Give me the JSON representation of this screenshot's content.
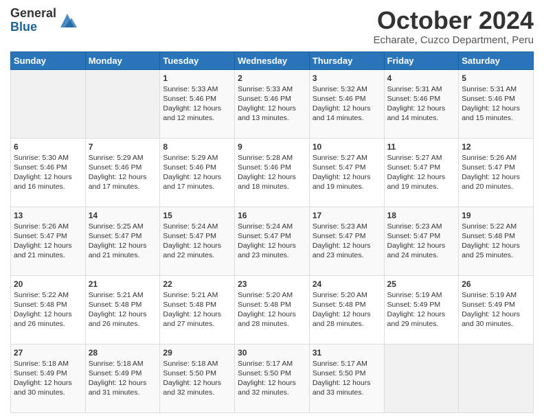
{
  "logo": {
    "general": "General",
    "blue": "Blue"
  },
  "header": {
    "title": "October 2024",
    "subtitle": "Echarate, Cuzco Department, Peru"
  },
  "weekdays": [
    "Sunday",
    "Monday",
    "Tuesday",
    "Wednesday",
    "Thursday",
    "Friday",
    "Saturday"
  ],
  "weeks": [
    [
      {
        "day": null,
        "sunrise": null,
        "sunset": null,
        "daylight": null
      },
      {
        "day": null,
        "sunrise": null,
        "sunset": null,
        "daylight": null
      },
      {
        "day": "1",
        "sunrise": "Sunrise: 5:33 AM",
        "sunset": "Sunset: 5:46 PM",
        "daylight": "Daylight: 12 hours and 12 minutes."
      },
      {
        "day": "2",
        "sunrise": "Sunrise: 5:33 AM",
        "sunset": "Sunset: 5:46 PM",
        "daylight": "Daylight: 12 hours and 13 minutes."
      },
      {
        "day": "3",
        "sunrise": "Sunrise: 5:32 AM",
        "sunset": "Sunset: 5:46 PM",
        "daylight": "Daylight: 12 hours and 14 minutes."
      },
      {
        "day": "4",
        "sunrise": "Sunrise: 5:31 AM",
        "sunset": "Sunset: 5:46 PM",
        "daylight": "Daylight: 12 hours and 14 minutes."
      },
      {
        "day": "5",
        "sunrise": "Sunrise: 5:31 AM",
        "sunset": "Sunset: 5:46 PM",
        "daylight": "Daylight: 12 hours and 15 minutes."
      }
    ],
    [
      {
        "day": "6",
        "sunrise": "Sunrise: 5:30 AM",
        "sunset": "Sunset: 5:46 PM",
        "daylight": "Daylight: 12 hours and 16 minutes."
      },
      {
        "day": "7",
        "sunrise": "Sunrise: 5:29 AM",
        "sunset": "Sunset: 5:46 PM",
        "daylight": "Daylight: 12 hours and 17 minutes."
      },
      {
        "day": "8",
        "sunrise": "Sunrise: 5:29 AM",
        "sunset": "Sunset: 5:46 PM",
        "daylight": "Daylight: 12 hours and 17 minutes."
      },
      {
        "day": "9",
        "sunrise": "Sunrise: 5:28 AM",
        "sunset": "Sunset: 5:46 PM",
        "daylight": "Daylight: 12 hours and 18 minutes."
      },
      {
        "day": "10",
        "sunrise": "Sunrise: 5:27 AM",
        "sunset": "Sunset: 5:47 PM",
        "daylight": "Daylight: 12 hours and 19 minutes."
      },
      {
        "day": "11",
        "sunrise": "Sunrise: 5:27 AM",
        "sunset": "Sunset: 5:47 PM",
        "daylight": "Daylight: 12 hours and 19 minutes."
      },
      {
        "day": "12",
        "sunrise": "Sunrise: 5:26 AM",
        "sunset": "Sunset: 5:47 PM",
        "daylight": "Daylight: 12 hours and 20 minutes."
      }
    ],
    [
      {
        "day": "13",
        "sunrise": "Sunrise: 5:26 AM",
        "sunset": "Sunset: 5:47 PM",
        "daylight": "Daylight: 12 hours and 21 minutes."
      },
      {
        "day": "14",
        "sunrise": "Sunrise: 5:25 AM",
        "sunset": "Sunset: 5:47 PM",
        "daylight": "Daylight: 12 hours and 21 minutes."
      },
      {
        "day": "15",
        "sunrise": "Sunrise: 5:24 AM",
        "sunset": "Sunset: 5:47 PM",
        "daylight": "Daylight: 12 hours and 22 minutes."
      },
      {
        "day": "16",
        "sunrise": "Sunrise: 5:24 AM",
        "sunset": "Sunset: 5:47 PM",
        "daylight": "Daylight: 12 hours and 23 minutes."
      },
      {
        "day": "17",
        "sunrise": "Sunrise: 5:23 AM",
        "sunset": "Sunset: 5:47 PM",
        "daylight": "Daylight: 12 hours and 23 minutes."
      },
      {
        "day": "18",
        "sunrise": "Sunrise: 5:23 AM",
        "sunset": "Sunset: 5:47 PM",
        "daylight": "Daylight: 12 hours and 24 minutes."
      },
      {
        "day": "19",
        "sunrise": "Sunrise: 5:22 AM",
        "sunset": "Sunset: 5:48 PM",
        "daylight": "Daylight: 12 hours and 25 minutes."
      }
    ],
    [
      {
        "day": "20",
        "sunrise": "Sunrise: 5:22 AM",
        "sunset": "Sunset: 5:48 PM",
        "daylight": "Daylight: 12 hours and 26 minutes."
      },
      {
        "day": "21",
        "sunrise": "Sunrise: 5:21 AM",
        "sunset": "Sunset: 5:48 PM",
        "daylight": "Daylight: 12 hours and 26 minutes."
      },
      {
        "day": "22",
        "sunrise": "Sunrise: 5:21 AM",
        "sunset": "Sunset: 5:48 PM",
        "daylight": "Daylight: 12 hours and 27 minutes."
      },
      {
        "day": "23",
        "sunrise": "Sunrise: 5:20 AM",
        "sunset": "Sunset: 5:48 PM",
        "daylight": "Daylight: 12 hours and 28 minutes."
      },
      {
        "day": "24",
        "sunrise": "Sunrise: 5:20 AM",
        "sunset": "Sunset: 5:48 PM",
        "daylight": "Daylight: 12 hours and 28 minutes."
      },
      {
        "day": "25",
        "sunrise": "Sunrise: 5:19 AM",
        "sunset": "Sunset: 5:49 PM",
        "daylight": "Daylight: 12 hours and 29 minutes."
      },
      {
        "day": "26",
        "sunrise": "Sunrise: 5:19 AM",
        "sunset": "Sunset: 5:49 PM",
        "daylight": "Daylight: 12 hours and 30 minutes."
      }
    ],
    [
      {
        "day": "27",
        "sunrise": "Sunrise: 5:18 AM",
        "sunset": "Sunset: 5:49 PM",
        "daylight": "Daylight: 12 hours and 30 minutes."
      },
      {
        "day": "28",
        "sunrise": "Sunrise: 5:18 AM",
        "sunset": "Sunset: 5:49 PM",
        "daylight": "Daylight: 12 hours and 31 minutes."
      },
      {
        "day": "29",
        "sunrise": "Sunrise: 5:18 AM",
        "sunset": "Sunset: 5:50 PM",
        "daylight": "Daylight: 12 hours and 32 minutes."
      },
      {
        "day": "30",
        "sunrise": "Sunrise: 5:17 AM",
        "sunset": "Sunset: 5:50 PM",
        "daylight": "Daylight: 12 hours and 32 minutes."
      },
      {
        "day": "31",
        "sunrise": "Sunrise: 5:17 AM",
        "sunset": "Sunset: 5:50 PM",
        "daylight": "Daylight: 12 hours and 33 minutes."
      },
      {
        "day": null,
        "sunrise": null,
        "sunset": null,
        "daylight": null
      },
      {
        "day": null,
        "sunrise": null,
        "sunset": null,
        "daylight": null
      }
    ]
  ]
}
